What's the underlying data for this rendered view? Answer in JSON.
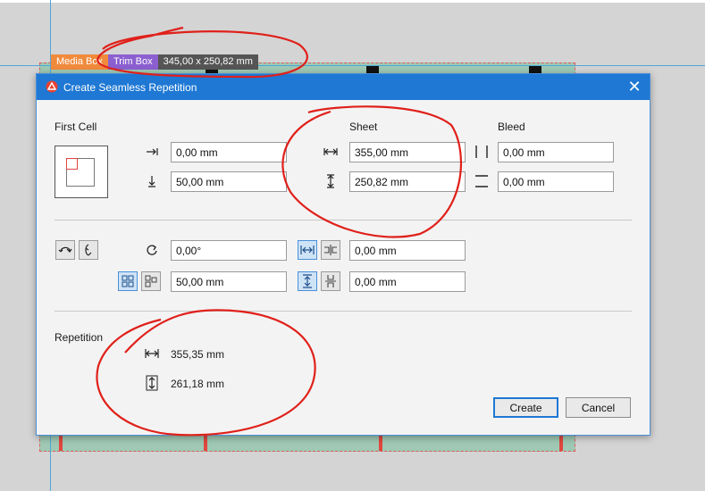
{
  "canvas": {
    "tags": {
      "media_box": "Media Box",
      "trim_box": "Trim Box",
      "size": "345,00 x 250,82 mm"
    }
  },
  "dialog": {
    "title": "Create Seamless Repetition",
    "close_symbol": "✕",
    "first_cell": {
      "label": "First Cell",
      "x_value": "0,00 mm",
      "y_value": "50,00 mm"
    },
    "sheet": {
      "label": "Sheet",
      "width_value": "355,00 mm",
      "height_value": "250,82 mm"
    },
    "bleed": {
      "label": "Bleed",
      "horizontal_value": "0,00 mm",
      "vertical_value": "0,00 mm"
    },
    "transform": {
      "rotation_value": "0,00°",
      "offset_value": "50,00 mm",
      "horizontal_gap_value": "0,00 mm",
      "vertical_gap_value": "0,00 mm"
    },
    "repetition": {
      "label": "Repetition",
      "width": "355,35 mm",
      "height": "261,18 mm"
    },
    "buttons": {
      "create": "Create",
      "cancel": "Cancel"
    }
  },
  "colors": {
    "titlebar": "#1e78d4",
    "annotation": "#e0201a",
    "media_box": "#f08a3c",
    "trim_box": "#8b5fcf"
  },
  "icons": [
    "arrow-right-bar-icon",
    "arrow-down-bar-icon",
    "width-arrows-icon",
    "height-arrows-icon",
    "bleed-horizontal-icon",
    "bleed-vertical-icon",
    "flip-horizontal-icon",
    "flip-vertical-icon",
    "rotate-icon",
    "grid-layout-icon",
    "offset-grid-icon",
    "spacing-horizontal-icon",
    "align-horizontal-icon",
    "spacing-vertical-icon",
    "align-vertical-icon",
    "repetition-width-icon",
    "repetition-height-icon",
    "close-icon"
  ]
}
